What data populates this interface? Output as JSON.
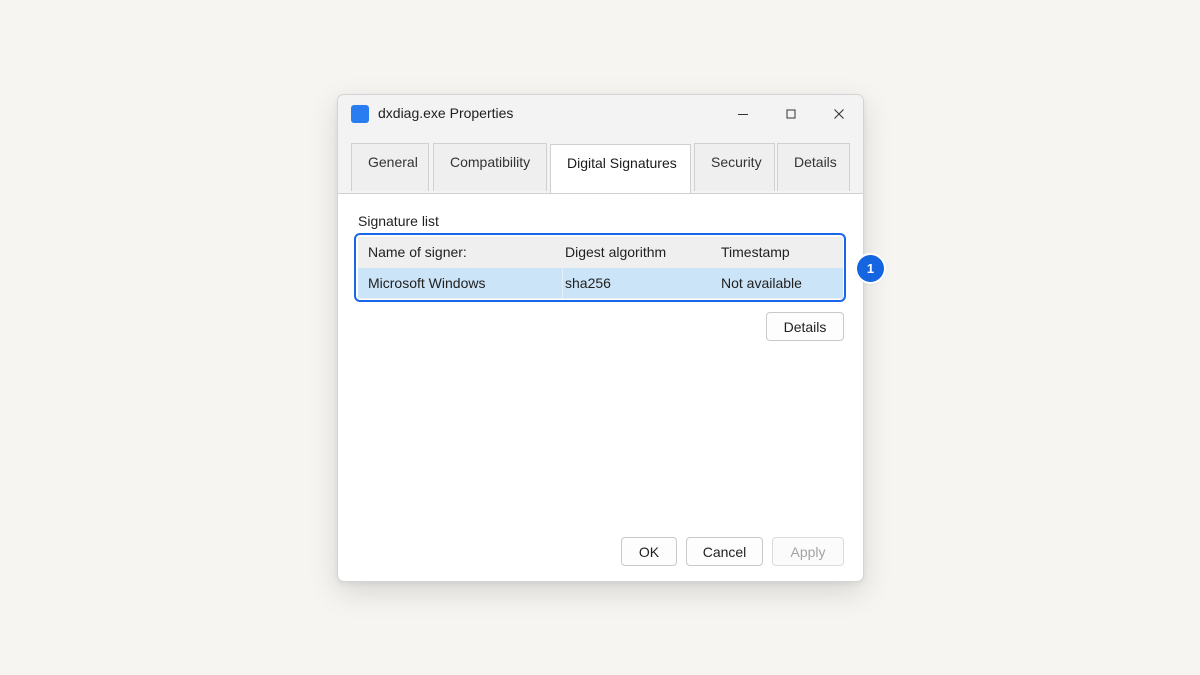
{
  "window": {
    "title": "dxdiag.exe Properties",
    "icon": "app-icon",
    "controls": {
      "minimize": "minimize-icon",
      "maximize": "maximize-icon",
      "close": "close-icon"
    }
  },
  "tabs": [
    {
      "label": "General",
      "active": false
    },
    {
      "label": "Compatibility",
      "active": false
    },
    {
      "label": "Digital Signatures",
      "active": true
    },
    {
      "label": "Security",
      "active": false
    },
    {
      "label": "Details",
      "active": false
    }
  ],
  "signatures": {
    "label": "Signature list",
    "columns": [
      "Name of signer:",
      "Digest algorithm",
      "Timestamp"
    ],
    "rows": [
      {
        "signer": "Microsoft Windows",
        "digest": "sha256",
        "timestamp": "Not available",
        "selected": true
      }
    ],
    "details_button": "Details"
  },
  "annotation": {
    "badge": "1",
    "color": "#1565e0"
  },
  "footer": {
    "ok": "OK",
    "cancel": "Cancel",
    "apply": "Apply",
    "apply_enabled": false
  },
  "colors": {
    "accent": "#1a66e8",
    "selection": "#cce4f7",
    "app_icon": "#2a7df1"
  }
}
